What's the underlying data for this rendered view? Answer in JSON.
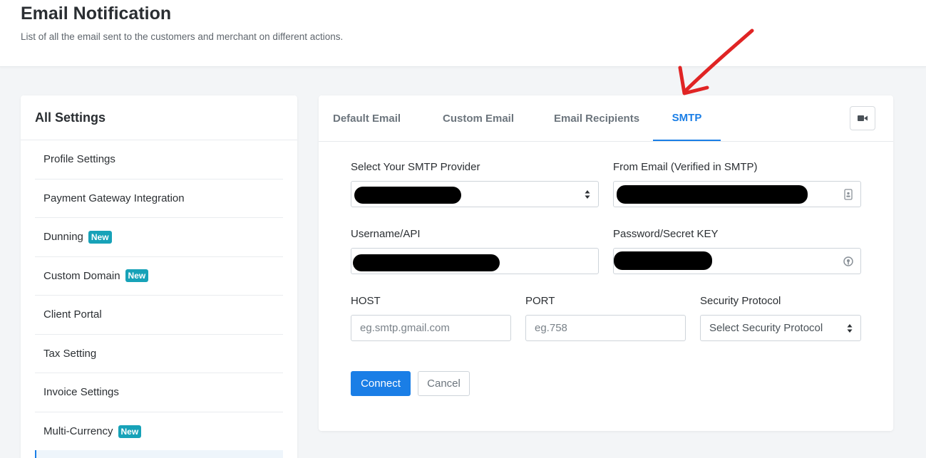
{
  "header": {
    "title": "Email Notification",
    "subtitle": "List of all the email sent to the customers and merchant on different actions."
  },
  "sidebar": {
    "title": "All Settings",
    "items": [
      {
        "label": "Profile Settings",
        "badge": ""
      },
      {
        "label": "Payment Gateway Integration",
        "badge": ""
      },
      {
        "label": "Dunning",
        "badge": "New"
      },
      {
        "label": "Custom Domain",
        "badge": "New"
      },
      {
        "label": "Client Portal",
        "badge": ""
      },
      {
        "label": "Tax Setting",
        "badge": ""
      },
      {
        "label": "Invoice Settings",
        "badge": ""
      },
      {
        "label": "Multi-Currency",
        "badge": "New"
      }
    ]
  },
  "tabs": [
    {
      "label": "Default Email",
      "active": false
    },
    {
      "label": "Custom Email",
      "active": false
    },
    {
      "label": "Email Recipients",
      "active": false
    },
    {
      "label": "SMTP",
      "active": true
    }
  ],
  "icons": {
    "video": "video-camera-icon",
    "select_arrows": "select-arrows-icon",
    "contact_card": "contact-card-icon",
    "password_key": "password-key-icon"
  },
  "form": {
    "provider_label": "Select Your SMTP Provider",
    "from_email_label": "From Email (Verified in SMTP)",
    "username_label": "Username/API",
    "password_label": "Password/Secret KEY",
    "host_label": "HOST",
    "host_placeholder": "eg.smtp.gmail.com",
    "port_label": "PORT",
    "port_placeholder": "eg.758",
    "security_label": "Security Protocol",
    "security_value": "Select Security Protocol",
    "connect_label": "Connect",
    "cancel_label": "Cancel"
  },
  "colors": {
    "accent": "#1a7ee6",
    "badge": "#17a2b8",
    "annotation": "#e02424"
  }
}
